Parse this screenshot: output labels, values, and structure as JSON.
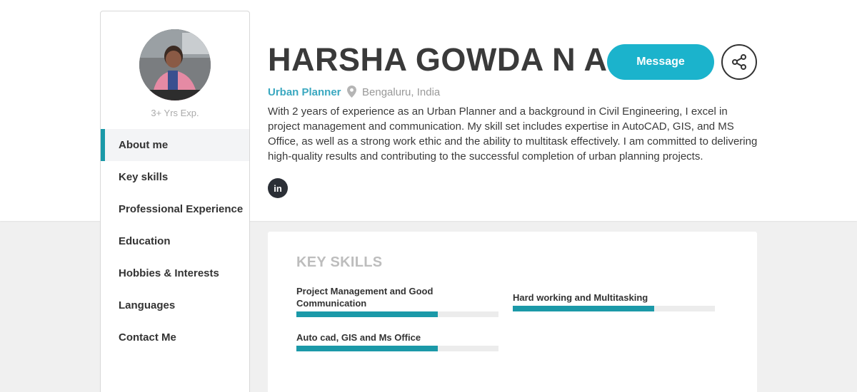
{
  "profile": {
    "name": "HARSHA GOWDA N A",
    "role": "Urban Planner",
    "location": "Bengaluru, India",
    "experience": "3+ Yrs Exp.",
    "bio": "With 2 years of experience as an Urban Planner and a background in Civil Engineering, I excel in project management and communication. My skill set includes expertise in AutoCAD, GIS, and MS Office, as well as a strong work ethic and the ability to multitask effectively. I am committed to delivering high-quality results and contributing to the successful completion of urban planning projects."
  },
  "actions": {
    "message_label": "Message",
    "share_icon": "share-icon"
  },
  "social": {
    "linkedin_label": "in"
  },
  "sidebar": {
    "items": [
      {
        "label": "About me",
        "active": true
      },
      {
        "label": "Key skills",
        "active": false
      },
      {
        "label": "Professional Experience",
        "active": false
      },
      {
        "label": "Education",
        "active": false
      },
      {
        "label": "Hobbies & Interests",
        "active": false
      },
      {
        "label": "Languages",
        "active": false
      },
      {
        "label": "Contact Me",
        "active": false
      }
    ]
  },
  "key_skills": {
    "title": "KEY SKILLS",
    "skills": [
      {
        "label": "Project Management and Good Communication",
        "level": 0.7
      },
      {
        "label": "Hard working and Multitasking",
        "level": 0.7
      },
      {
        "label": "Auto cad, GIS and Ms Office",
        "level": 0.7
      }
    ]
  },
  "colors": {
    "accent": "#1b99a8",
    "button": "#1bb3cc",
    "role_text": "#3aa8c0"
  }
}
